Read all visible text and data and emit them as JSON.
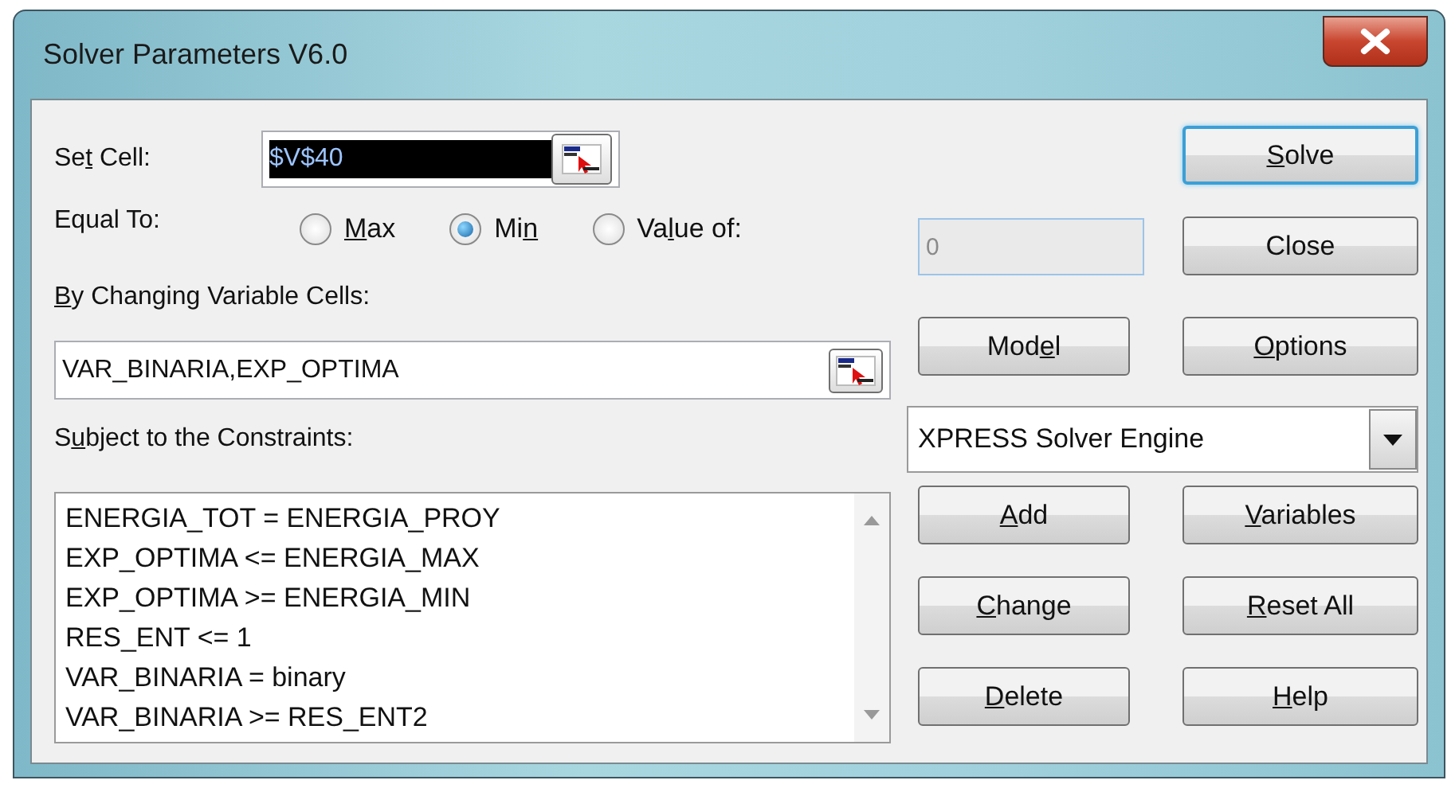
{
  "window": {
    "title": "Solver Parameters V6.0"
  },
  "set_cell": {
    "label": [
      {
        "text": "Se",
        "underlined": false
      },
      {
        "text": "t",
        "underlined": true
      },
      {
        "text": " Cell:",
        "underlined": false
      }
    ],
    "value": "$V$40",
    "text_selected": true
  },
  "equal_to": {
    "label": [
      {
        "text": "Equal To:",
        "underlined": false
      }
    ],
    "options": [
      {
        "label": [
          {
            "text": "M",
            "underlined": true
          },
          {
            "text": "ax",
            "underlined": false
          }
        ],
        "selected": false
      },
      {
        "label": [
          {
            "text": "Mi",
            "underlined": false
          },
          {
            "text": "n",
            "underlined": true
          }
        ],
        "selected": true
      },
      {
        "label": [
          {
            "text": "Va",
            "underlined": false
          },
          {
            "text": "l",
            "underlined": true
          },
          {
            "text": "ue of:",
            "underlined": false
          }
        ],
        "selected": false
      }
    ],
    "value_field": {
      "value": "0",
      "disabled": true
    }
  },
  "changing_cells": {
    "label": [
      {
        "text": "B",
        "underlined": true
      },
      {
        "text": "y Changing Variable Cells:",
        "underlined": false
      }
    ],
    "value": "VAR_BINARIA,EXP_OPTIMA"
  },
  "constraints": {
    "label": [
      {
        "text": "S",
        "underlined": false
      },
      {
        "text": "u",
        "underlined": true
      },
      {
        "text": "bject to the Constraints:",
        "underlined": false
      }
    ],
    "items": [
      "ENERGIA_TOT = ENERGIA_PROY",
      "EXP_OPTIMA <= ENERGIA_MAX",
      "EXP_OPTIMA >= ENERGIA_MIN",
      "RES_ENT <= 1",
      "VAR_BINARIA = binary",
      "VAR_BINARIA >= RES_ENT2"
    ]
  },
  "engine": {
    "value": "XPRESS Solver Engine"
  },
  "buttons": [
    {
      "label": [
        {
          "text": "S",
          "underlined": true
        },
        {
          "text": "olve",
          "underlined": false
        }
      ],
      "focused": true
    },
    {
      "label": [
        {
          "text": "Close",
          "underlined": false
        }
      ],
      "focused": false
    },
    {
      "label": [
        {
          "text": "Mod",
          "underlined": false
        },
        {
          "text": "e",
          "underlined": true
        },
        {
          "text": "l",
          "underlined": false
        }
      ],
      "focused": false
    },
    {
      "label": [
        {
          "text": "O",
          "underlined": true
        },
        {
          "text": "ptions",
          "underlined": false
        }
      ],
      "focused": false
    },
    {
      "label": [
        {
          "text": "A",
          "underlined": true
        },
        {
          "text": "dd",
          "underlined": false
        }
      ],
      "focused": false
    },
    {
      "label": [
        {
          "text": "V",
          "underlined": true
        },
        {
          "text": "ariables",
          "underlined": false
        }
      ],
      "focused": false
    },
    {
      "label": [
        {
          "text": "C",
          "underlined": true
        },
        {
          "text": "hange",
          "underlined": false
        }
      ],
      "focused": false
    },
    {
      "label": [
        {
          "text": "R",
          "underlined": true
        },
        {
          "text": "eset All",
          "underlined": false
        }
      ],
      "focused": false
    },
    {
      "label": [
        {
          "text": "D",
          "underlined": true
        },
        {
          "text": "elete",
          "underlined": false
        }
      ],
      "focused": false
    },
    {
      "label": [
        {
          "text": "H",
          "underlined": true
        },
        {
          "text": "elp",
          "underlined": false
        }
      ],
      "focused": false
    }
  ]
}
